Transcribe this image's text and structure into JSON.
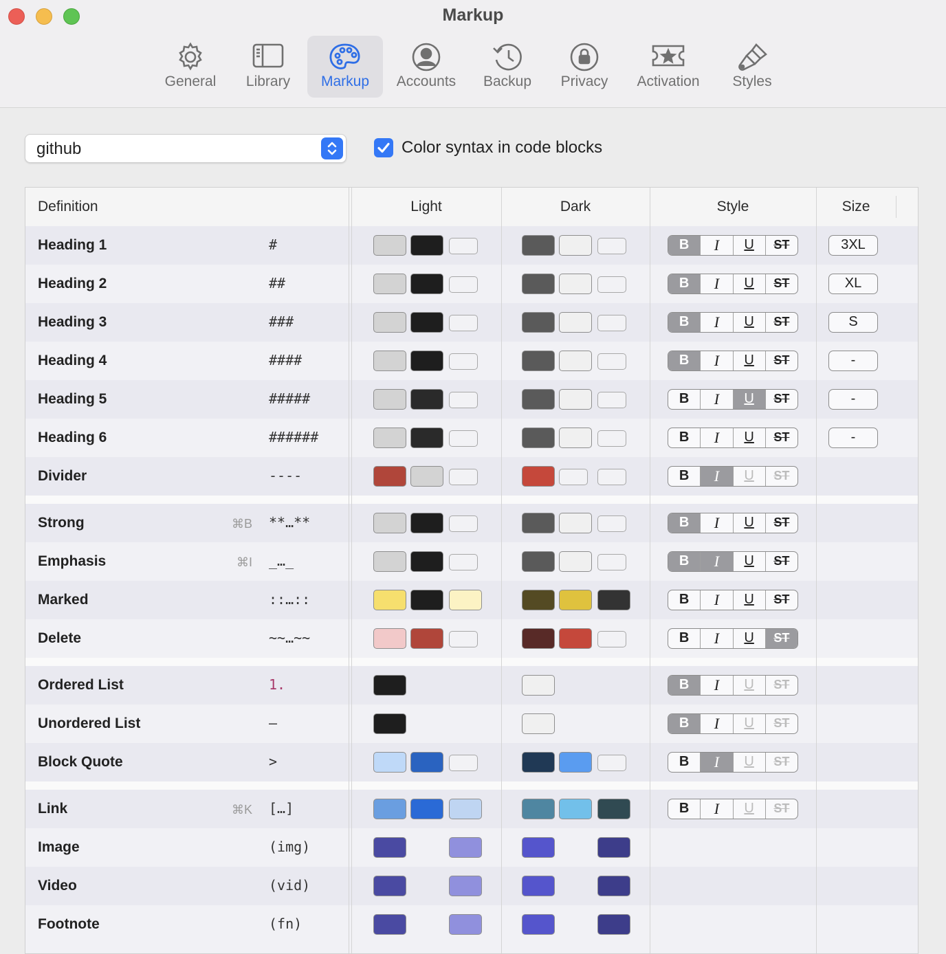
{
  "window": {
    "title": "Markup"
  },
  "toolbar": {
    "items": [
      {
        "label": "General",
        "icon": "gear-icon"
      },
      {
        "label": "Library",
        "icon": "library-icon"
      },
      {
        "label": "Markup",
        "icon": "palette-icon",
        "selected": true
      },
      {
        "label": "Accounts",
        "icon": "person-circle-icon"
      },
      {
        "label": "Backup",
        "icon": "clock-arrow-icon"
      },
      {
        "label": "Privacy",
        "icon": "lock-circle-icon"
      },
      {
        "label": "Activation",
        "icon": "ticket-star-icon"
      },
      {
        "label": "Styles",
        "icon": "paintbrush-icon"
      }
    ]
  },
  "theme_select": {
    "value": "github"
  },
  "syntax_option": {
    "label": "Color syntax in code blocks",
    "checked": true
  },
  "table": {
    "columns": [
      "Definition",
      "Light",
      "Dark",
      "Style",
      "Size"
    ],
    "rows": [
      {
        "definition": "Heading 1",
        "shortcut": "",
        "markup": "#",
        "light": [
          "#d3d3d3",
          "#1e1e1e",
          ""
        ],
        "dark": [
          "#5a5a5a",
          "#f0f0f0",
          ""
        ],
        "style": [
          "on",
          "off",
          "off",
          "off"
        ],
        "size": "3XL"
      },
      {
        "definition": "Heading 2",
        "shortcut": "",
        "markup": "##",
        "light": [
          "#d3d3d3",
          "#1e1e1e",
          ""
        ],
        "dark": [
          "#5a5a5a",
          "#f0f0f0",
          ""
        ],
        "style": [
          "on",
          "off",
          "off",
          "off"
        ],
        "size": "XL"
      },
      {
        "definition": "Heading 3",
        "shortcut": "",
        "markup": "###",
        "light": [
          "#d3d3d3",
          "#1e1e1e",
          ""
        ],
        "dark": [
          "#5a5a5a",
          "#f0f0f0",
          ""
        ],
        "style": [
          "on",
          "off",
          "off",
          "off"
        ],
        "size": "S"
      },
      {
        "definition": "Heading 4",
        "shortcut": "",
        "markup": "####",
        "light": [
          "#d3d3d3",
          "#1e1e1e",
          ""
        ],
        "dark": [
          "#5a5a5a",
          "#f0f0f0",
          ""
        ],
        "style": [
          "on",
          "off",
          "off",
          "off"
        ],
        "size": "-"
      },
      {
        "definition": "Heading 5",
        "shortcut": "",
        "markup": "#####",
        "light": [
          "#d3d3d3",
          "#2a2a2a",
          ""
        ],
        "dark": [
          "#5a5a5a",
          "#f0f0f0",
          ""
        ],
        "style": [
          "off",
          "off",
          "on",
          "off"
        ],
        "size": "-"
      },
      {
        "definition": "Heading 6",
        "shortcut": "",
        "markup": "######",
        "light": [
          "#d3d3d3",
          "#2a2a2a",
          ""
        ],
        "dark": [
          "#5a5a5a",
          "#f0f0f0",
          ""
        ],
        "style": [
          "off",
          "off",
          "off",
          "off"
        ],
        "size": "-"
      },
      {
        "definition": "Divider",
        "shortcut": "",
        "markup": "----",
        "light": [
          "#b0463a",
          "#d3d3d3",
          ""
        ],
        "dark": [
          "#c5483b",
          "",
          ""
        ],
        "style": [
          "off",
          "on",
          "dim",
          "dim"
        ],
        "size": ""
      },
      {
        "definition": "Strong",
        "shortcut": "⌘B",
        "markup": "**…**",
        "light": [
          "#d3d3d3",
          "#1e1e1e",
          ""
        ],
        "dark": [
          "#5a5a5a",
          "#f0f0f0",
          ""
        ],
        "style": [
          "on",
          "off",
          "off",
          "off"
        ],
        "size": ""
      },
      {
        "definition": "Emphasis",
        "shortcut": "⌘I",
        "markup": "_…_",
        "light": [
          "#d3d3d3",
          "#1e1e1e",
          ""
        ],
        "dark": [
          "#5a5a5a",
          "#f0f0f0",
          ""
        ],
        "style": [
          "on",
          "on",
          "off",
          "off"
        ],
        "size": ""
      },
      {
        "definition": "Marked",
        "shortcut": "",
        "markup": "::…::",
        "light": [
          "#f6df6e",
          "#1e1e1e",
          "#fcf3c4"
        ],
        "dark": [
          "#544a23",
          "#dfc23e",
          "#333333"
        ],
        "style": [
          "off",
          "off",
          "off",
          "off"
        ],
        "size": ""
      },
      {
        "definition": "Delete",
        "shortcut": "",
        "markup": "~~…~~",
        "light": [
          "#f2c9c9",
          "#b0463a",
          ""
        ],
        "dark": [
          "#582a27",
          "#c5483b",
          ""
        ],
        "style": [
          "off",
          "off",
          "off",
          "on"
        ],
        "size": ""
      },
      {
        "definition": "Ordered List",
        "shortcut": "",
        "markup": "1.",
        "light": [
          "#1e1e1e"
        ],
        "dark": [
          "#f0f0f0"
        ],
        "style": [
          "on",
          "off",
          "dim",
          "dim"
        ],
        "size": ""
      },
      {
        "definition": "Unordered List",
        "shortcut": "",
        "markup": "–",
        "light": [
          "#1e1e1e"
        ],
        "dark": [
          "#f0f0f0"
        ],
        "style": [
          "on",
          "off",
          "dim",
          "dim"
        ],
        "size": ""
      },
      {
        "definition": "Block Quote",
        "shortcut": "",
        "markup": ">",
        "light": [
          "#bfd9f8",
          "#2a63c0",
          ""
        ],
        "dark": [
          "#203955",
          "#5a9cf0",
          ""
        ],
        "style": [
          "off",
          "on",
          "dim",
          "dim"
        ],
        "size": ""
      },
      {
        "definition": "Link",
        "shortcut": "⌘K",
        "markup": "[…]",
        "light": [
          "#6a9ee0",
          "#2a6ad6",
          "#bfd5f2"
        ],
        "dark": [
          "#4f86a1",
          "#72c0ea",
          "#304a52"
        ],
        "style": [
          "off",
          "off",
          "dim",
          "dim"
        ],
        "size": ""
      },
      {
        "definition": "Image",
        "shortcut": "",
        "markup": "(img)",
        "light": [
          "#4a4aa2",
          null,
          "#9090dd"
        ],
        "dark": [
          "#5555cc",
          null,
          "#3d3d8a"
        ],
        "style": [],
        "size": ""
      },
      {
        "definition": "Video",
        "shortcut": "",
        "markup": "(vid)",
        "light": [
          "#4a4aa2",
          null,
          "#9090dd"
        ],
        "dark": [
          "#5555cc",
          null,
          "#3d3d8a"
        ],
        "style": [],
        "size": ""
      },
      {
        "definition": "Footnote",
        "shortcut": "",
        "markup": "(fn)",
        "light": [
          "#4a4aa2",
          null,
          "#9090dd"
        ],
        "dark": [
          "#5555cc",
          null,
          "#3d3d8a"
        ],
        "style": [],
        "size": ""
      }
    ]
  },
  "style_labels": [
    "B",
    "I",
    "U",
    "ST"
  ],
  "colors": {
    "accent": "#3478f6",
    "close": "#ec5f57",
    "minimize": "#f5bd4f",
    "zoom": "#5fc454"
  }
}
